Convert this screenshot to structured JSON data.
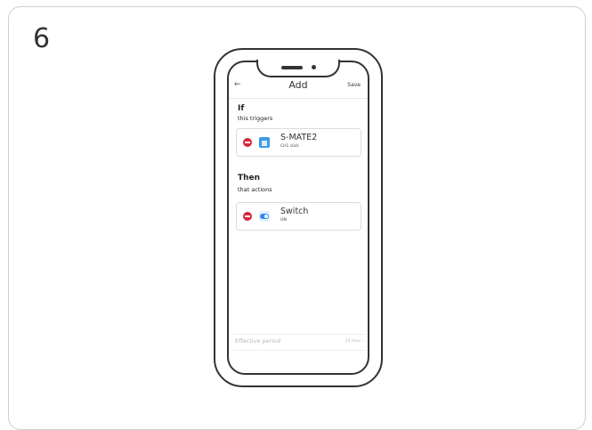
{
  "step": {
    "number": "6"
  },
  "header": {
    "back": "←",
    "title": "Add",
    "save_label": "Save"
  },
  "if_section": {
    "title": "If",
    "subtitle": "this triggers",
    "item": {
      "name": "S-MATE2",
      "detail": "CH1 click"
    }
  },
  "then_section": {
    "title": "Then",
    "subtitle": "that actions",
    "item": {
      "name": "Switch",
      "detail": "ON"
    }
  },
  "period": {
    "label": "Effective period",
    "value": "24 Hour ›"
  },
  "colors": {
    "remove": "#d6263b",
    "accent": "#2d8ef0",
    "home_tile": "#3b9be8"
  },
  "icons": {
    "back": "arrow-left-icon",
    "remove": "minus-circle-icon",
    "trigger": "home-icon",
    "action": "switch-toggle-icon"
  }
}
